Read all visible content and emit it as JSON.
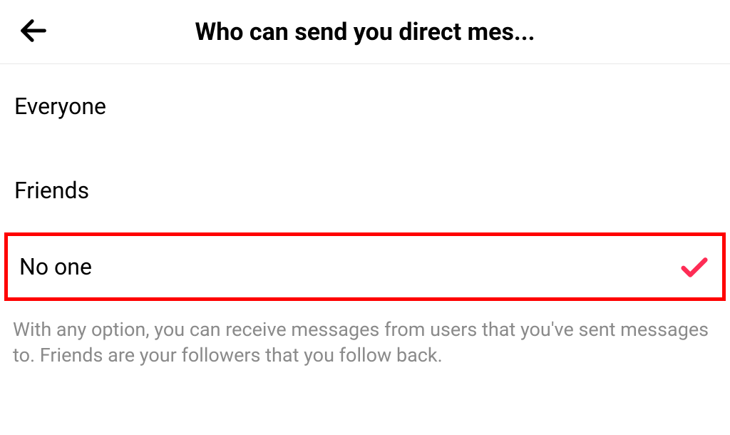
{
  "header": {
    "title": "Who can send you direct mes..."
  },
  "options": [
    {
      "label": "Everyone",
      "selected": false
    },
    {
      "label": "Friends",
      "selected": false
    },
    {
      "label": "No one",
      "selected": true
    }
  ],
  "helper_text": "With any option, you can receive messages from users that you've sent messages to. Friends are your followers that you follow back.",
  "colors": {
    "check": "#fe2c55",
    "highlight_border": "#ff0000"
  }
}
